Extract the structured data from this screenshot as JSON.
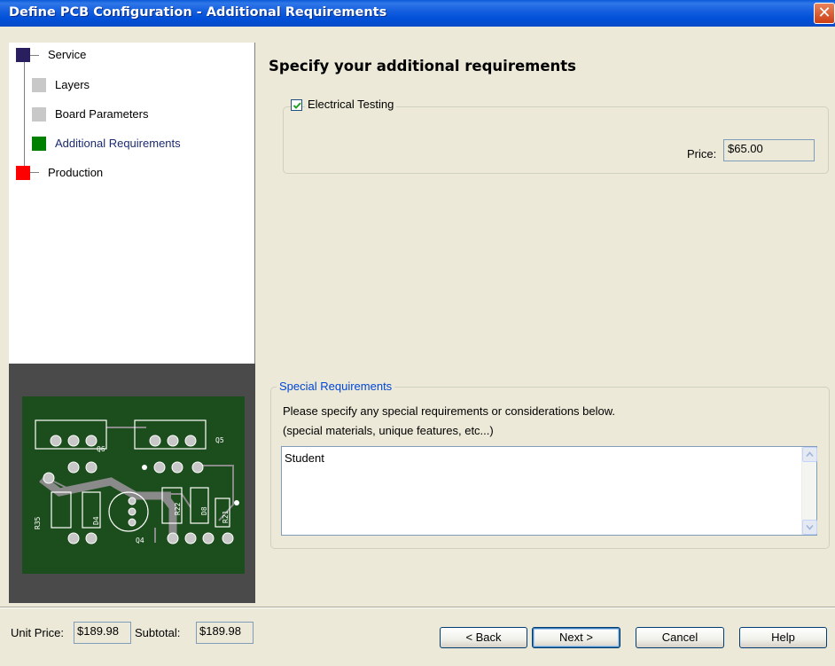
{
  "window": {
    "title": "Define PCB Configuration - Additional Requirements",
    "close_glyph": "✕"
  },
  "tree": {
    "items": [
      {
        "label": "Service",
        "color": "#2a1f5e"
      },
      {
        "label": "Layers",
        "color": "#c8c8c8"
      },
      {
        "label": "Board Parameters",
        "color": "#c8c8c8"
      },
      {
        "label": "Additional Requirements",
        "color": "#008000"
      },
      {
        "label": "Production",
        "color": "#ff0000"
      }
    ]
  },
  "main": {
    "heading": "Specify your additional requirements",
    "electrical_testing": {
      "label": "Electrical Testing",
      "checked": true,
      "price_label": "Price:",
      "price_value": "$65.00"
    },
    "special": {
      "legend": "Special Requirements",
      "instruction_1": "Please specify any special requirements or considerations below.",
      "instruction_2": "(special materials, unique features, etc...)",
      "text_value": "Student"
    }
  },
  "footer": {
    "unit_price_label": "Unit Price:",
    "unit_price_value": "$189.98",
    "subtotal_label": "Subtotal:",
    "subtotal_value": "$189.98",
    "back_label": "< Back",
    "next_label": "Next >",
    "cancel_label": "Cancel",
    "help_label": "Help"
  },
  "pcb_labels": [
    "Q6",
    "Q5",
    "R35",
    "D4",
    "Q4",
    "R22",
    "D8",
    "R21"
  ],
  "colors": {
    "titlebar": "#0054e3",
    "accent_link": "#0046d5",
    "pcb_green": "#1c4d1c",
    "pcb_trace": "#8a8a8a"
  }
}
